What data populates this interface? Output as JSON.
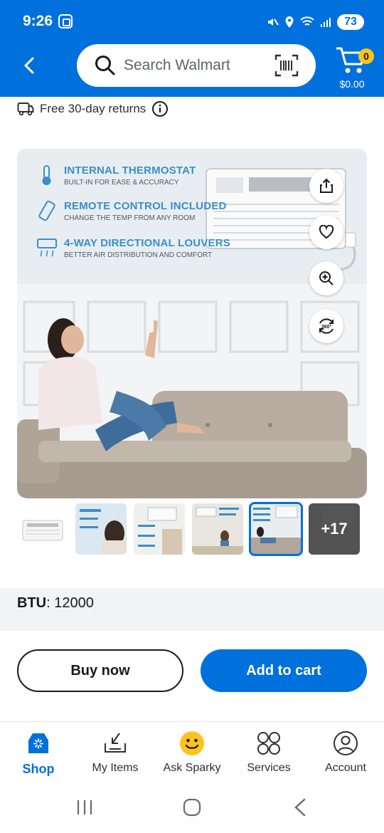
{
  "status_bar": {
    "time": "9:26",
    "battery": "73"
  },
  "header": {
    "search": {
      "placeholder": "Search Walmart"
    },
    "cart": {
      "count": "0",
      "total": "$0.00"
    }
  },
  "returns": {
    "text": "Free 30-day returns"
  },
  "hero": {
    "features": [
      {
        "title": "INTERNAL THERMOSTAT",
        "subtitle": "BUILT-IN FOR EASE & ACCURACY",
        "icon": "thermometer-icon"
      },
      {
        "title": "REMOTE CONTROL INCLUDED",
        "subtitle": "CHANGE THE TEMP FROM ANY ROOM",
        "icon": "remote-icon"
      },
      {
        "title": "4-WAY DIRECTIONAL LOUVERS",
        "subtitle": "BETTER AIR DISTRIBUTION AND COMFORT",
        "icon": "louver-icon"
      }
    ],
    "actions": [
      "share-icon",
      "heart-icon",
      "zoom-in-icon",
      "360-view-icon"
    ]
  },
  "thumbnails": {
    "selected_index": 4,
    "more_label": "+17"
  },
  "spec": {
    "label": "BTU",
    "value": ": 12000"
  },
  "cta": {
    "buy_now": "Buy now",
    "add_to_cart": "Add to cart"
  },
  "bottom_nav": [
    {
      "label": "Shop",
      "icon": "shop-icon",
      "active": true
    },
    {
      "label": "My Items",
      "icon": "my-items-icon"
    },
    {
      "label": "Ask Sparky",
      "icon": "sparky-icon"
    },
    {
      "label": "Services",
      "icon": "services-icon"
    },
    {
      "label": "Account",
      "icon": "account-icon"
    }
  ],
  "colors": {
    "brand_blue": "#0071dc",
    "spark_yellow": "#ffc220"
  }
}
